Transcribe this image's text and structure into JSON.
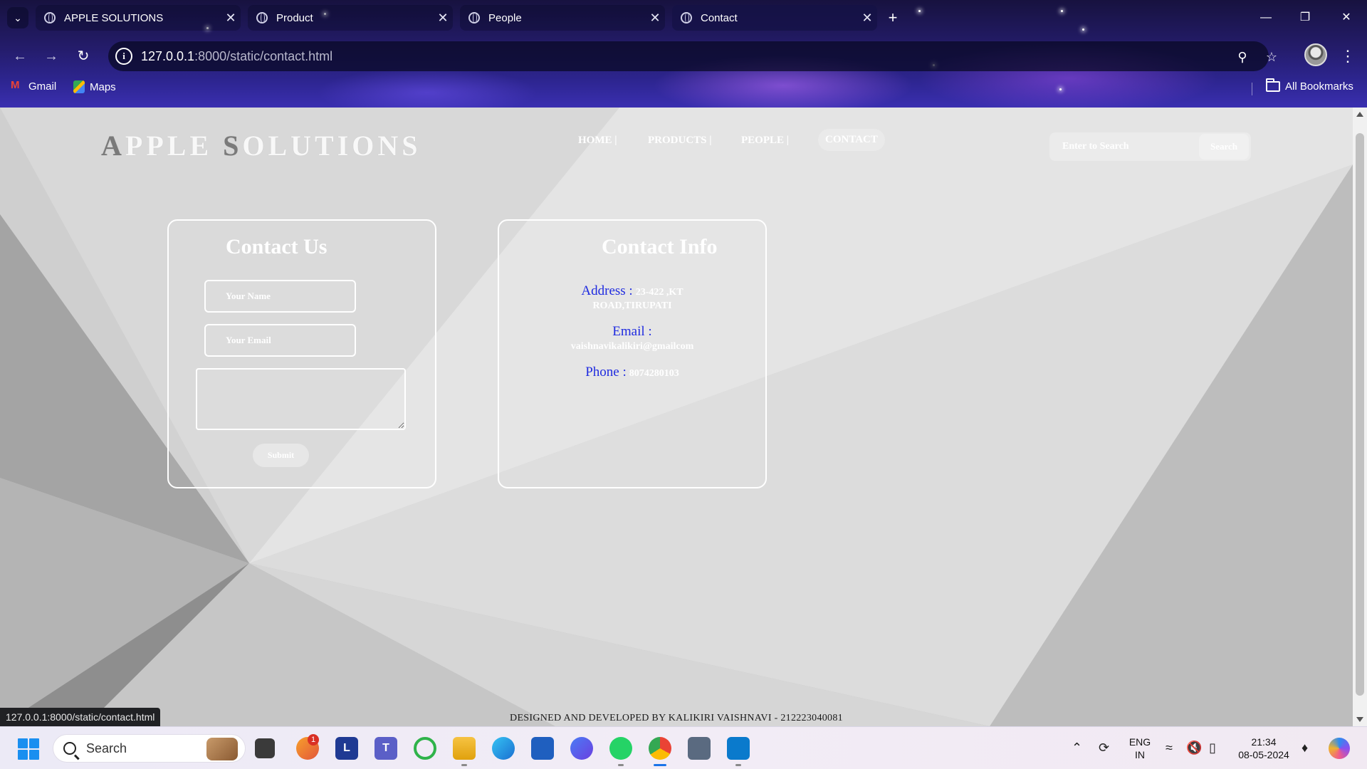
{
  "browser": {
    "tabs": [
      {
        "title": "APPLE SOLUTIONS",
        "active": false
      },
      {
        "title": "Product",
        "active": false
      },
      {
        "title": "People",
        "active": false
      },
      {
        "title": "Contact",
        "active": true
      }
    ],
    "url_host": "127.0.0.1",
    "url_rest": ":8000/static/contact.html",
    "bookmarks": {
      "gmail": "Gmail",
      "maps": "Maps",
      "all": "All Bookmarks"
    },
    "status_url": "127.0.0.1:8000/static/contact.html"
  },
  "site": {
    "brand": {
      "part1": "A",
      "part2": "PPLE ",
      "part3": "S",
      "part4": "OLUTIONS"
    },
    "nav": {
      "home": "HOME |",
      "products": "PRODUCTS |",
      "people": "PEOPLE |",
      "contact": "CONTACT"
    },
    "search": {
      "placeholder": "Enter to Search",
      "button": "Search"
    }
  },
  "contact_form": {
    "title": "Contact Us",
    "name_placeholder": "Your Name",
    "email_placeholder": "Your Email",
    "submit": "Submit"
  },
  "contact_info": {
    "title": "Contact Info",
    "address_label": "Address :",
    "address_line1": "23-422 ,KT",
    "address_line2": "ROAD,TIRUPATI",
    "email_label": "Email :",
    "email_value": "vaishnavikalikiri@gmailcom",
    "phone_label": "Phone :",
    "phone_value": "8074280103"
  },
  "footer": "DESIGNED AND DEVELOPED BY KALIKIRI VAISHNAVI - 212223040081",
  "taskbar": {
    "search_label": "Search",
    "language_top": "ENG",
    "language_bottom": "IN",
    "time": "21:34",
    "date": "08-05-2024",
    "outlook_badge": "1"
  },
  "colors": {
    "info_label": "#1f2be0",
    "page_bg": "#d2d2d2",
    "taskbar_active": "#1a73e8"
  }
}
